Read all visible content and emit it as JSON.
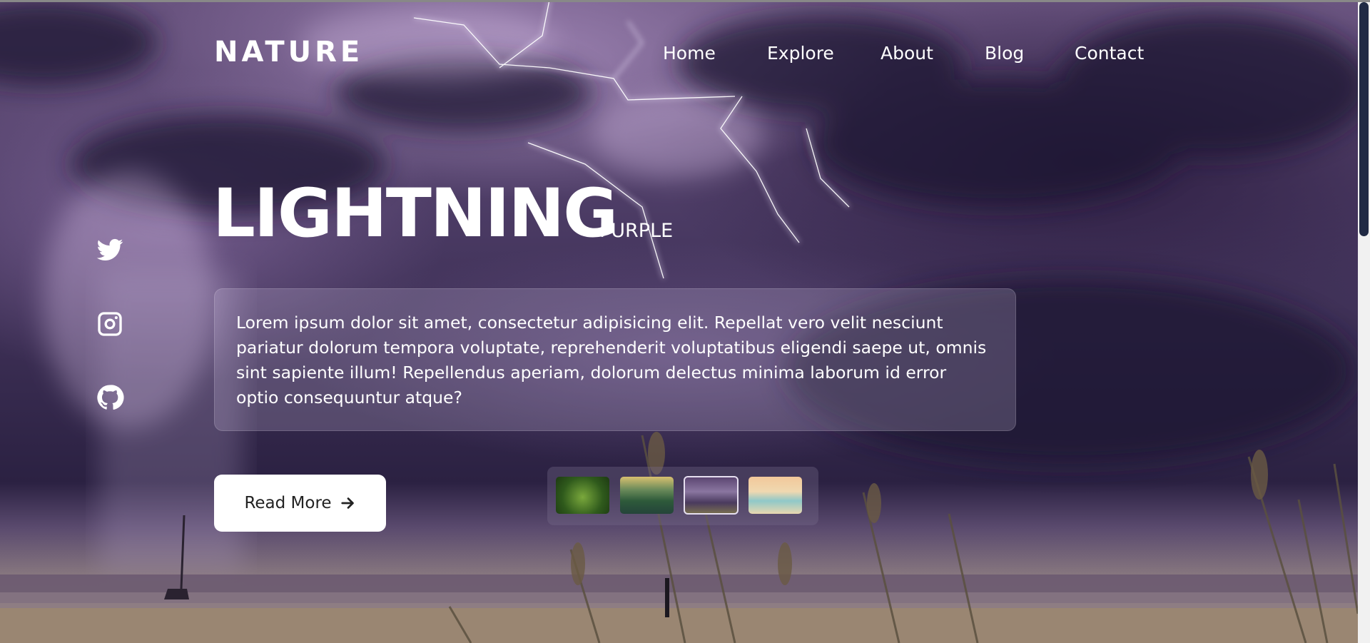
{
  "brand": {
    "logo": "NATURE"
  },
  "nav": {
    "items": [
      "Home",
      "Explore",
      "About",
      "Blog",
      "Contact"
    ]
  },
  "socials": [
    {
      "icon": "twitter-icon"
    },
    {
      "icon": "instagram-icon"
    },
    {
      "icon": "github-icon"
    }
  ],
  "hero": {
    "title": "LIGHTNING",
    "tag": "PURPLE",
    "description": "Lorem ipsum dolor sit amet, consectetur adipisicing elit. Repellat vero velit nesciunt pariatur dolorum tempora voluptate, reprehenderit voluptatibus eligendi saepe ut, omnis sint sapiente illum! Repellendus aperiam, dolorum delectus minima laborum id error optio consequuntur atque?",
    "cta_label": "Read More"
  },
  "thumbnails": {
    "items": [
      "forest-thumbnail",
      "mountain-lake-thumbnail",
      "lightning-thumbnail",
      "beach-sunset-thumbnail"
    ],
    "active_index": 2
  },
  "colors": {
    "text": "#ffffff",
    "button_bg": "#ffffff",
    "button_text": "#222222",
    "scroll_thumb": "#202a44"
  }
}
